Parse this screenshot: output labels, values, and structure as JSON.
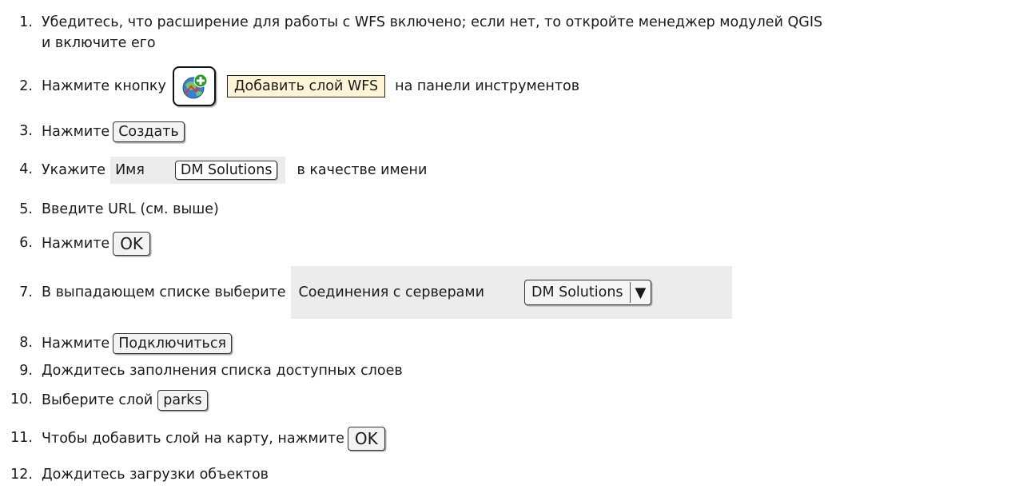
{
  "steps": [
    {
      "num": "1.",
      "text": "Убедитесь, что расширение для работы с WFS включено; если нет, то откройте менеджер модулей QGIS",
      "text2": "и включите его"
    },
    {
      "num": "2.",
      "before": "Нажмите кнопку",
      "tooltip": "Добавить слой WFS",
      "after": "на панели инструментов",
      "icon": "add-wfs-layer-icon"
    },
    {
      "num": "3.",
      "before": "Нажмите",
      "button": "Создать"
    },
    {
      "num": "4.",
      "before": "Укажите",
      "field_label": "Имя",
      "field_value": "DM Solutions",
      "after": "в качестве имени"
    },
    {
      "num": "5.",
      "text": "Введите URL (см. выше)"
    },
    {
      "num": "6.",
      "before": "Нажмите",
      "button": "OK"
    },
    {
      "num": "7.",
      "before": "В выпадающем списке выберите",
      "combo_label": "Соединения с серверами",
      "combo_value": "DM Solutions",
      "combo_arrow": "▼"
    },
    {
      "num": "8.",
      "before": "Нажмите",
      "button": "Подключиться"
    },
    {
      "num": "9.",
      "text": "Дождитесь заполнения списка доступных слоев"
    },
    {
      "num": "10.",
      "before": "Выберите слой",
      "button": "parks"
    },
    {
      "num": "11.",
      "before": "Чтобы добавить слой на карту, нажмите",
      "button": "OK"
    },
    {
      "num": "12.",
      "text": "Дождитесь загрузки объектов"
    }
  ]
}
